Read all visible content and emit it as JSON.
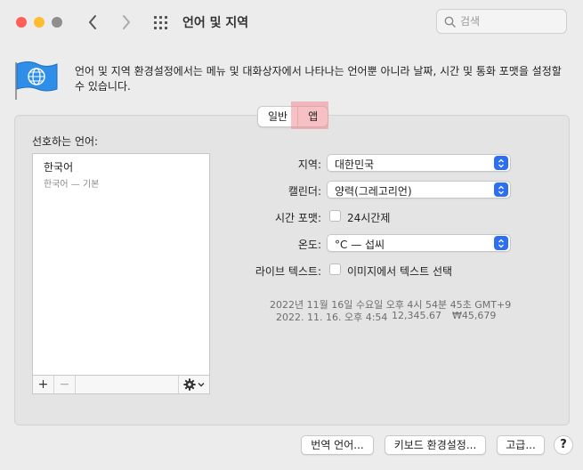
{
  "window": {
    "title": "언어 및 지역"
  },
  "search": {
    "placeholder": "검색"
  },
  "description": "언어 및 지역 환경설정에서는 메뉴 및 대화상자에서 나타나는 언어뿐 아니라 날짜, 시간 및 통화 포맷을 설정할 수 있습니다.",
  "tabs": [
    {
      "label": "일반"
    },
    {
      "label": "앱"
    }
  ],
  "preferred_languages": {
    "label": "선호하는 언어:",
    "items": [
      {
        "name": "한국어",
        "sub": "한국어 — 기본"
      }
    ]
  },
  "form": {
    "region": {
      "label": "지역:",
      "value": "대한민국"
    },
    "calendar": {
      "label": "캘린더:",
      "value": "양력(그레고리언)"
    },
    "time_format": {
      "label": "시간 포맷:",
      "option": "24시간제",
      "checked": false
    },
    "temperature": {
      "label": "온도:",
      "value": "°C — 섭씨"
    },
    "live_text": {
      "label": "라이브 텍스트:",
      "option": "이미지에서 텍스트 선택",
      "checked": false
    }
  },
  "sample": {
    "line1": "2022년 11월 16일 수요일 오후 4시 54분 45초 GMT+9",
    "line2_date": "2022. 11. 16. 오후 4:54",
    "line2_number": "12,345.67",
    "line2_currency": "₩45,679"
  },
  "buttons": {
    "translation": "번역 언어...",
    "keyboard": "키보드 환경설정...",
    "advanced": "고급...",
    "help": "?"
  },
  "list_controls": {
    "add": "+",
    "remove": "−"
  },
  "colors": {
    "accent": "#2e6ff2",
    "close": "#ff5f57",
    "minimize": "#febc2e",
    "zoom": "#8e8e8e",
    "tab_highlight": "#f08c96"
  }
}
